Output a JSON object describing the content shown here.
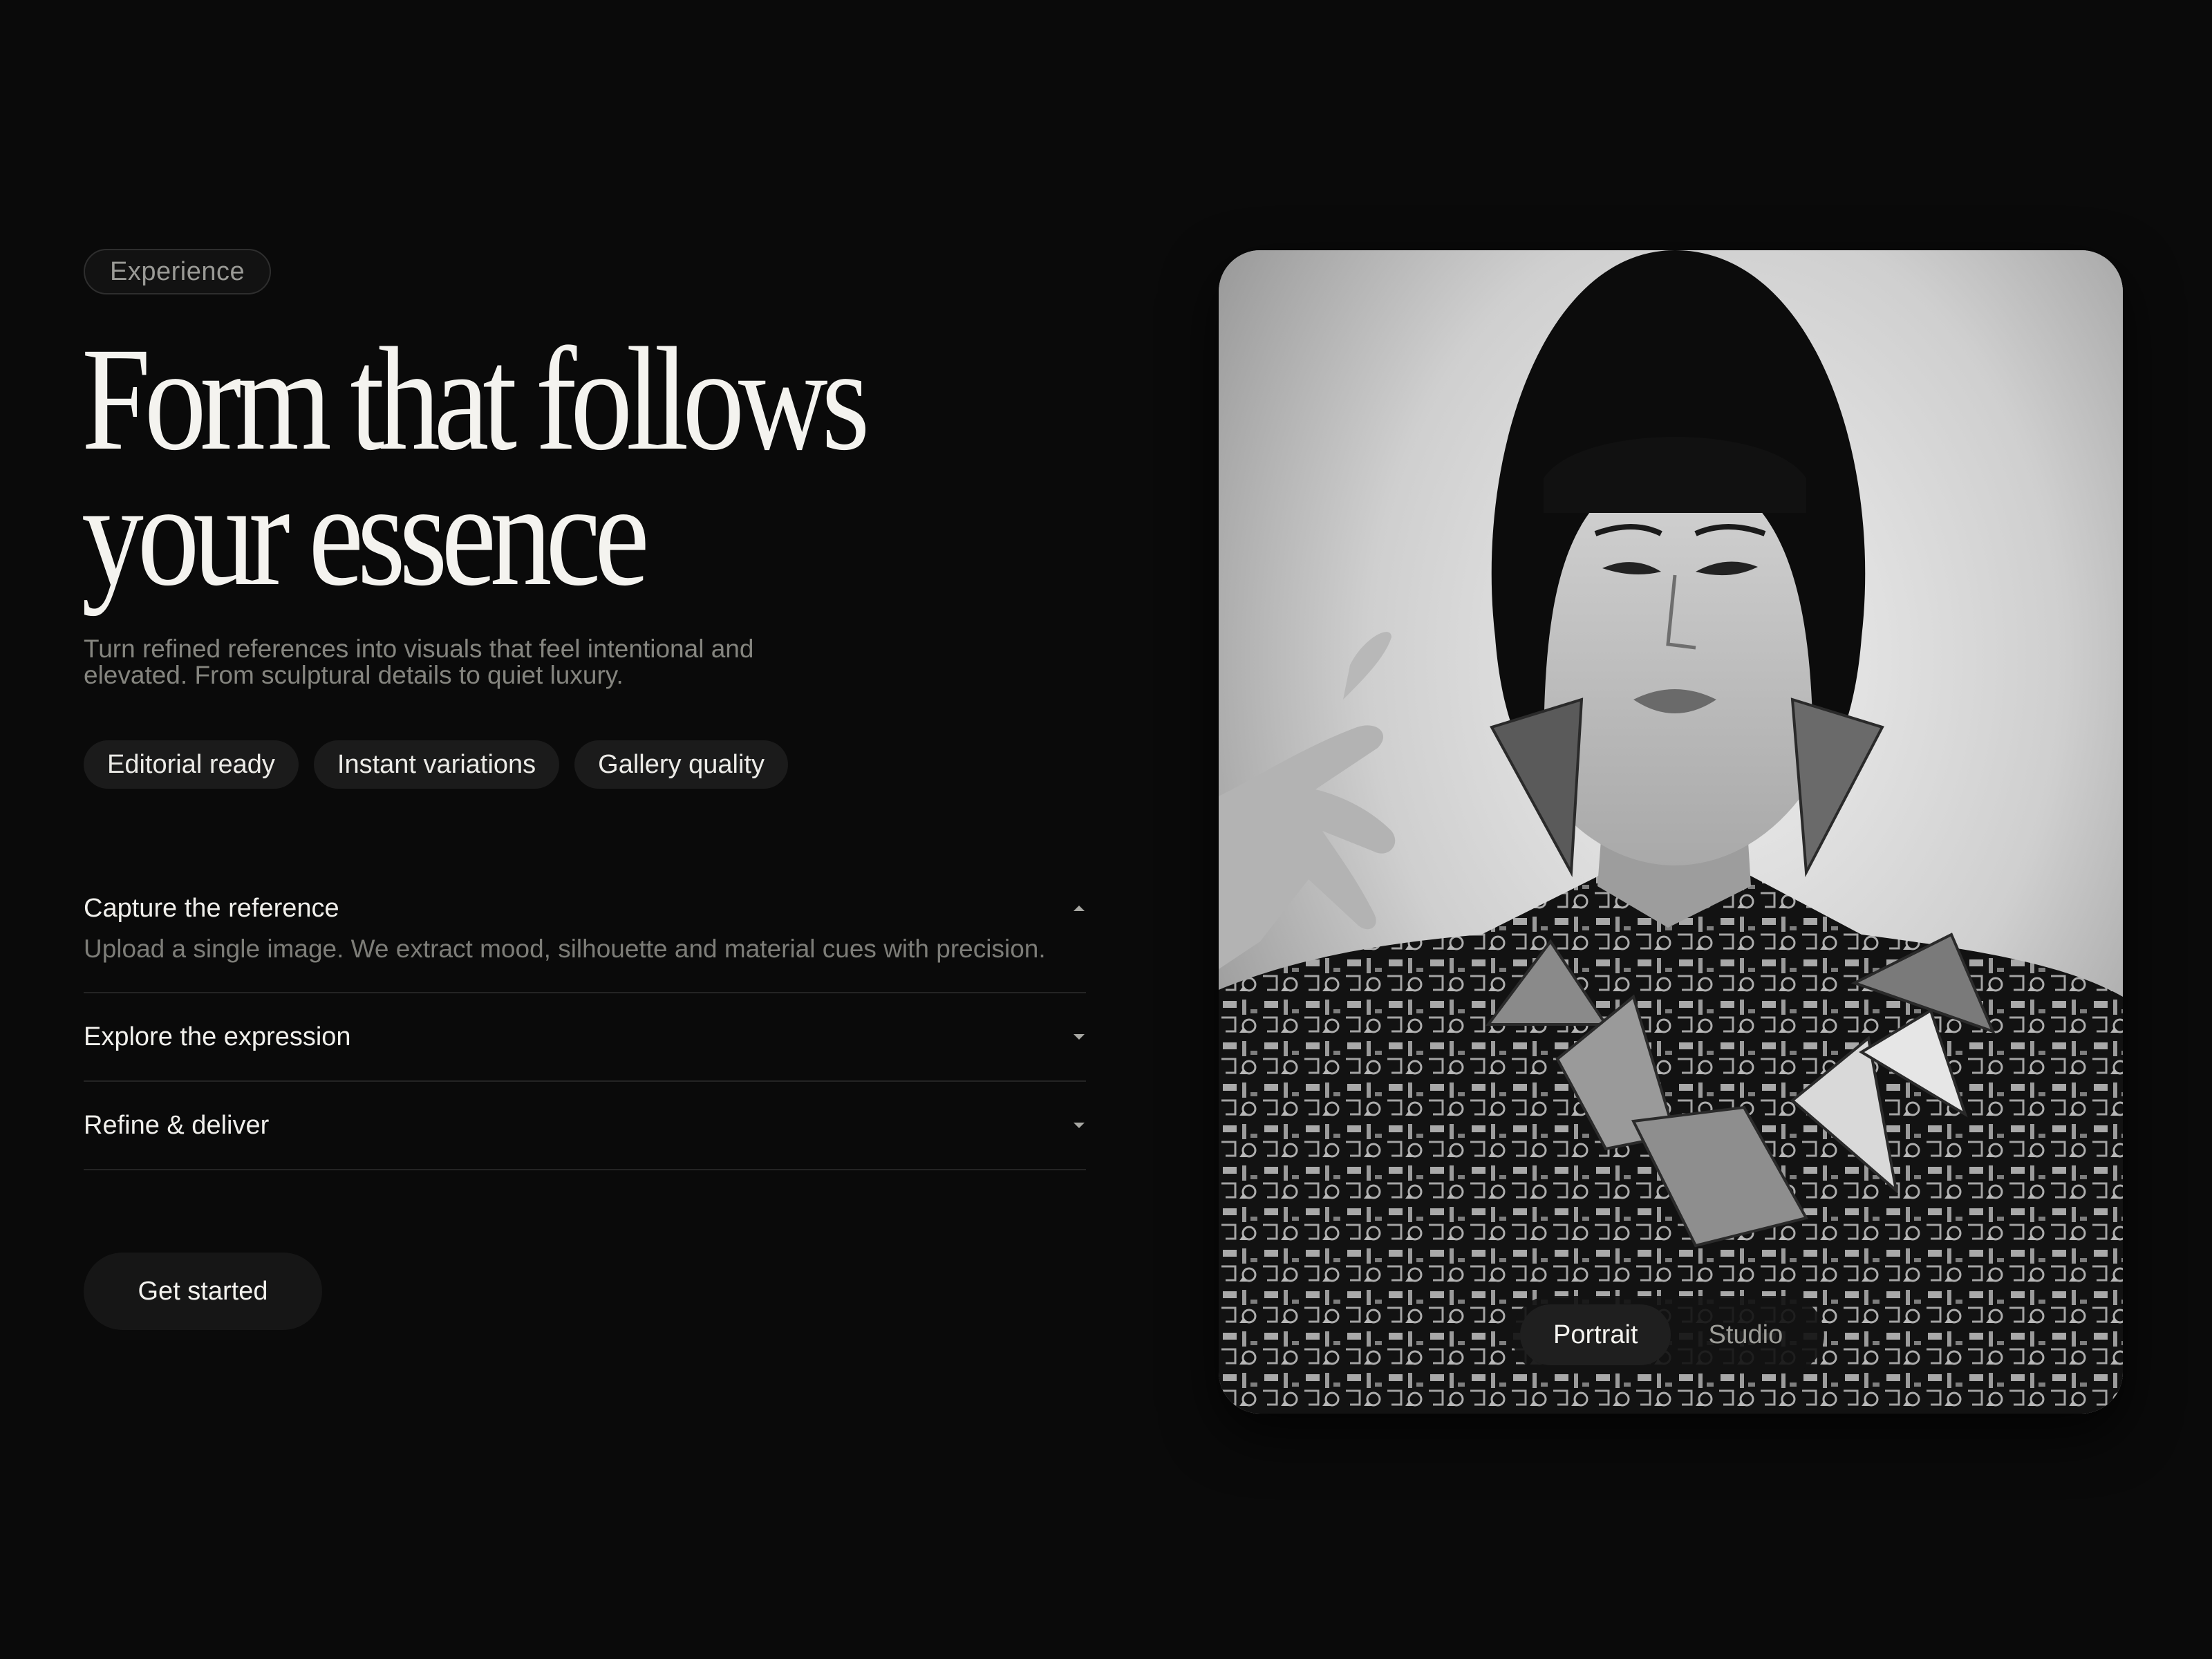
{
  "hero": {
    "eyebrow": "Experience",
    "headline_line1": "Form that follows",
    "headline_line2": "your essence",
    "subcopy": "Turn refined references into visuals that feel intentional and elevated. From sculptural details to quiet luxury."
  },
  "chips": [
    {
      "label": "Editorial ready"
    },
    {
      "label": "Instant variations"
    },
    {
      "label": "Gallery quality"
    }
  ],
  "accordion": [
    {
      "title": "Capture the reference",
      "body": "Upload a single image. We extract mood, silhouette and material cues with precision.",
      "expanded": true,
      "icon": "chevron-up-icon"
    },
    {
      "title": "Explore the expression",
      "expanded": false,
      "icon": "chevron-down-icon"
    },
    {
      "title": "Refine & deliver",
      "expanded": false,
      "icon": "chevron-down-icon"
    }
  ],
  "cta": {
    "label": "Get started"
  },
  "preview": {
    "image": "black-and-white portrait of a model with a bob haircut, geometric earrings and patterned jacket",
    "modes": [
      {
        "label": "Portrait",
        "active": true
      },
      {
        "label": "Studio",
        "active": false
      }
    ]
  },
  "colors": {
    "background": "#0a0a0a",
    "text_primary": "#f4f3ef",
    "text_muted": "#85857f",
    "chip_bg": "#1b1b1b",
    "divider": "#242424"
  }
}
